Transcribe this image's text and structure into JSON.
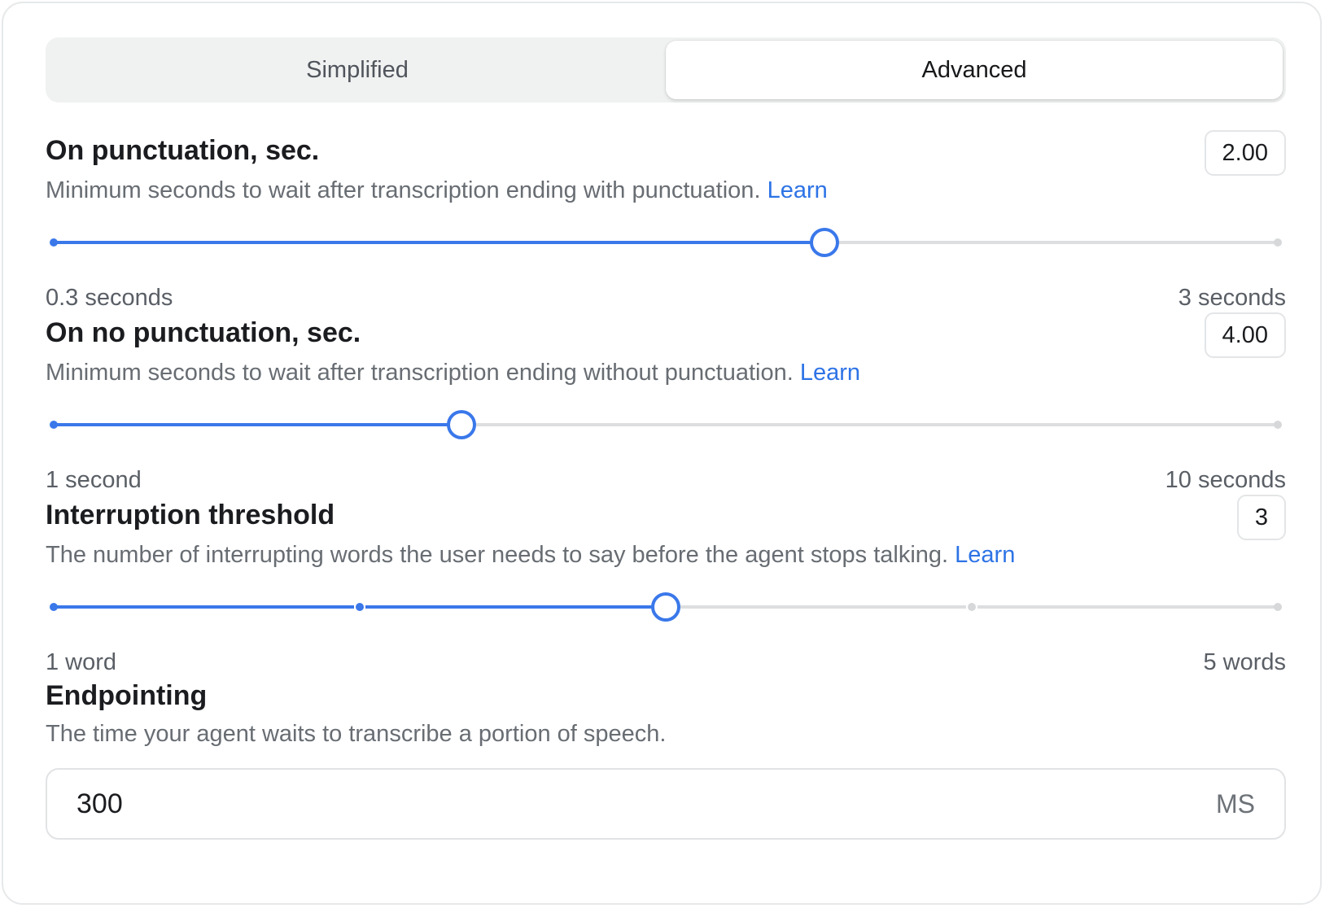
{
  "tabs": [
    {
      "label": "Simplified",
      "active": false
    },
    {
      "label": "Advanced",
      "active": true
    }
  ],
  "settings": [
    {
      "title": "On punctuation, sec.",
      "value": "2.00",
      "description": "Minimum seconds to wait after transcription ending with punctuation.",
      "learn": "Learn",
      "min_label": "0.3 seconds",
      "max_label": "3 seconds",
      "slider": {
        "min": 0.3,
        "max": 3,
        "value": 2.0
      }
    },
    {
      "title": "On no punctuation, sec.",
      "value": "4.00",
      "description": "Minimum seconds to wait after transcription ending without punctuation.",
      "learn": "Learn",
      "min_label": "1 second",
      "max_label": "10 seconds",
      "slider": {
        "min": 1,
        "max": 10,
        "value": 4.0
      }
    },
    {
      "title": "Interruption threshold",
      "value": "3",
      "description": "The number of interrupting words the user needs to say before the agent stops talking.",
      "learn": "Learn",
      "min_label": "1 word",
      "max_label": "5 words",
      "slider": {
        "min": 1,
        "max": 5,
        "value": 3,
        "step": 1
      }
    }
  ],
  "endpointing": {
    "title": "Endpointing",
    "description": "The time your agent waits to transcribe a portion of speech.",
    "value": "300",
    "unit": "MS"
  },
  "colors": {
    "accent": "#3a78ea",
    "link": "#2d73e6",
    "track": "#dcdee0"
  }
}
